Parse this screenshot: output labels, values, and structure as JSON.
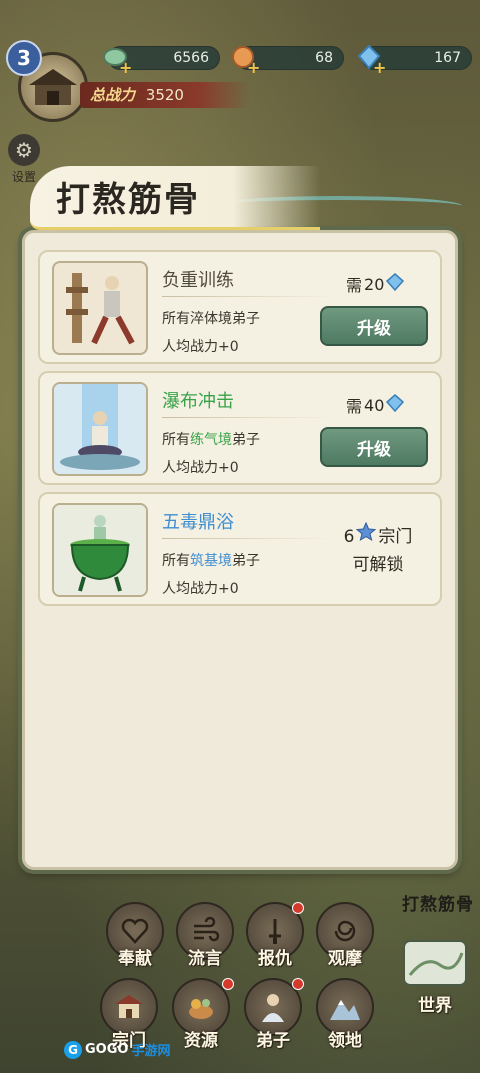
{
  "hud": {
    "level": "3",
    "currencies": [
      {
        "icon": "jade-icon",
        "value": "6566"
      },
      {
        "icon": "peach-icon",
        "value": "68"
      },
      {
        "icon": "crystal-icon",
        "value": "167"
      }
    ],
    "power_label": "总战力",
    "power_value": "3520",
    "settings_label": "设置"
  },
  "dialog": {
    "title": "打熬筋骨",
    "cards": [
      {
        "name": "负重训练",
        "requirement_prefix": "所有",
        "requirement_realm": "淬体境弟子",
        "power": "人均战力+0",
        "cost_prefix": "需",
        "cost_value": "20",
        "action": "升级"
      },
      {
        "name": "瀑布冲击",
        "requirement_prefix": "所有",
        "requirement_realm": "练气境",
        "requirement_suffix": "弟子",
        "power": "人均战力+0",
        "cost_prefix": "需",
        "cost_value": "40",
        "action": "升级"
      },
      {
        "name": "五毒鼎浴",
        "requirement_prefix": "所有",
        "requirement_realm": "筑基境",
        "requirement_suffix": "弟子",
        "power": "人均战力+0",
        "unlock_level": "6",
        "unlock_unit": "宗门",
        "unlock_text": "可解锁"
      }
    ]
  },
  "side_label": "打熬筋骨",
  "nav": {
    "row1": [
      "奉献",
      "流言",
      "报仇",
      "观摩"
    ],
    "row2": [
      "宗门",
      "资源",
      "弟子",
      "领地"
    ],
    "world": "世界"
  },
  "watermark": {
    "prefix": "GOGO",
    "suffix": "手游网"
  },
  "colors": {
    "green_text": "#3aa34a",
    "blue_text": "#3f8ed0",
    "button": "#5f8a70"
  }
}
